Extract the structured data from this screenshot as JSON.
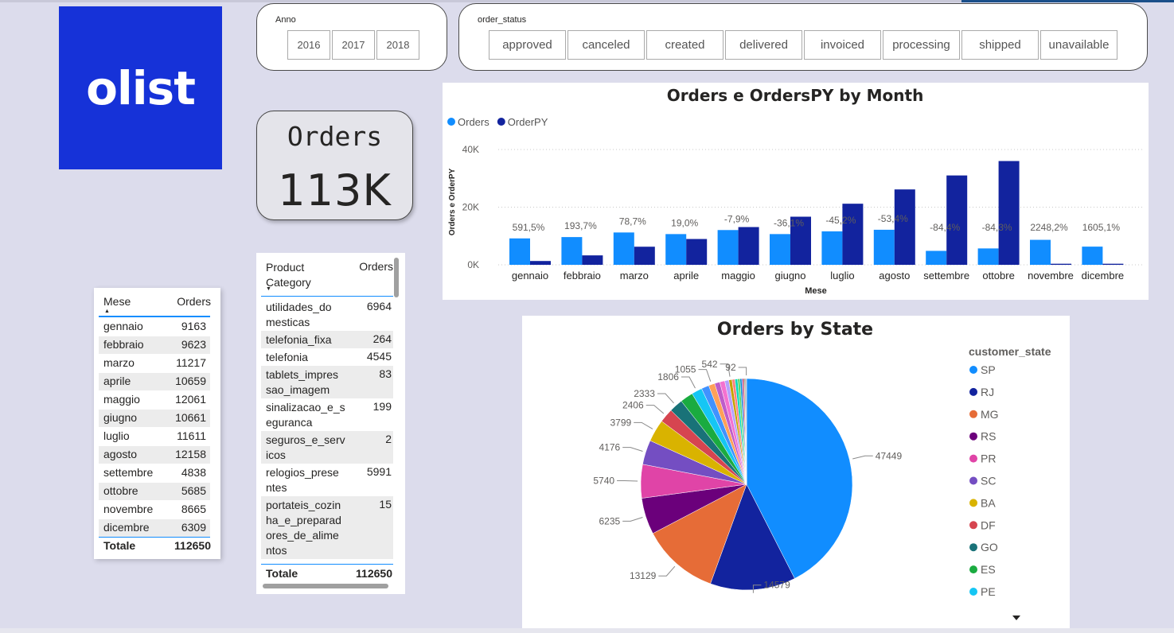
{
  "logo": {
    "text": "olist"
  },
  "anno_slicer": {
    "title": "Anno",
    "items": [
      "2016",
      "2017",
      "2018"
    ]
  },
  "status_slicer": {
    "title": "order_status",
    "items": [
      "approved",
      "canceled",
      "created",
      "delivered",
      "invoiced",
      "processing",
      "shipped",
      "unavailable"
    ]
  },
  "kpi_card": {
    "label": "Orders",
    "value": "113K"
  },
  "month_table": {
    "headers": [
      "Mese",
      "Orders"
    ],
    "rows": [
      [
        "gennaio",
        "9163"
      ],
      [
        "febbraio",
        "9623"
      ],
      [
        "marzo",
        "11217"
      ],
      [
        "aprile",
        "10659"
      ],
      [
        "maggio",
        "12061"
      ],
      [
        "giugno",
        "10661"
      ],
      [
        "luglio",
        "11611"
      ],
      [
        "agosto",
        "12158"
      ],
      [
        "settembre",
        "4838"
      ],
      [
        "ottobre",
        "5685"
      ],
      [
        "novembre",
        "8665"
      ],
      [
        "dicembre",
        "6309"
      ]
    ],
    "total": [
      "Totale",
      "112650"
    ]
  },
  "category_table": {
    "headers": [
      "Product Category",
      "Orders"
    ],
    "rows": [
      [
        [
          "utilidades_do",
          "mesticas"
        ],
        "6964"
      ],
      [
        [
          "telefonia_fixa"
        ],
        "264"
      ],
      [
        [
          "telefonia"
        ],
        "4545"
      ],
      [
        [
          "tablets_impres",
          "sao_imagem"
        ],
        "83"
      ],
      [
        [
          "sinalizacao_e_s",
          "eguranca"
        ],
        "199"
      ],
      [
        [
          "seguros_e_serv",
          "icos"
        ],
        "2"
      ],
      [
        [
          "relogios_prese",
          "ntes"
        ],
        "5991"
      ],
      [
        [
          "portateis_cozin",
          "ha_e_preparad",
          "ores_de_alime",
          "ntos"
        ],
        "15"
      ]
    ],
    "total": [
      "Totale",
      "112650"
    ]
  },
  "chart_data": [
    {
      "type": "bar",
      "title": "Orders e OrdersPY by Month",
      "xlabel": "Mese",
      "ylabel": "Orders e OrderPY",
      "ylim": [
        0,
        40000
      ],
      "yticks": [
        "0K",
        "20K",
        "40K"
      ],
      "yticks_values": [
        0,
        20000,
        40000
      ],
      "legend_position": "top-left",
      "categories": [
        "gennaio",
        "febbraio",
        "marzo",
        "aprile",
        "maggio",
        "giugno",
        "luglio",
        "agosto",
        "settembre",
        "ottobre",
        "novembre",
        "dicembre"
      ],
      "series": [
        {
          "name": "Orders",
          "color": "#118dff",
          "values": [
            9163,
            9623,
            11217,
            10659,
            12061,
            10661,
            11611,
            12158,
            4838,
            5685,
            8665,
            6309
          ]
        },
        {
          "name": "OrderPY",
          "color": "#12239e",
          "values": [
            1325,
            3273,
            6278,
            8957,
            13097,
            16689,
            21193,
            26150,
            31000,
            36000,
            369,
            370
          ]
        }
      ],
      "labels": [
        "591,5%",
        "193,7%",
        "78,7%",
        "19,0%",
        "-7,9%",
        "-36,1%",
        "-45,2%",
        "-53,4%",
        "-84,4%",
        "-84,3%",
        "2248,2%",
        "1605,1%"
      ]
    },
    {
      "type": "pie",
      "title": "Orders by State",
      "legend_title": "customer_state",
      "legend_position": "right",
      "slices": [
        {
          "name": "SP",
          "value": 47449,
          "color": "#118dff",
          "label": "47449"
        },
        {
          "name": "RJ",
          "value": 14579,
          "color": "#12239e",
          "label": "14579"
        },
        {
          "name": "MG",
          "value": 13129,
          "color": "#e66c37",
          "label": "13129"
        },
        {
          "name": "RS",
          "value": 6235,
          "color": "#6b007b",
          "label": "6235"
        },
        {
          "name": "PR",
          "value": 5740,
          "color": "#e044a7",
          "label": "5740"
        },
        {
          "name": "SC",
          "value": 4176,
          "color": "#744ec2",
          "label": "4176"
        },
        {
          "name": "BA",
          "value": 3799,
          "color": "#d9b300",
          "label": "3799"
        },
        {
          "name": "DF",
          "value": 2406,
          "color": "#d64550",
          "label": "2406"
        },
        {
          "name": "GO",
          "value": 2333,
          "color": "#197278",
          "label": "2333"
        },
        {
          "name": "ES",
          "value": 2200,
          "color": "#1aab40",
          "label": ""
        },
        {
          "name": "PE",
          "value": 1806,
          "color": "#15c6f4",
          "label": "1806"
        },
        {
          "name": "",
          "value": 1300,
          "color": "#4092ff",
          "label": ""
        },
        {
          "name": "",
          "value": 1055,
          "color": "#ffa058",
          "label": "1055"
        },
        {
          "name": "",
          "value": 900,
          "color": "#be5dc9",
          "label": ""
        },
        {
          "name": "",
          "value": 850,
          "color": "#f472d0",
          "label": ""
        },
        {
          "name": "",
          "value": 700,
          "color": "#b5a1ff",
          "label": ""
        },
        {
          "name": "",
          "value": 542,
          "color": "#c4a200",
          "label": "542"
        },
        {
          "name": "",
          "value": 500,
          "color": "#ff8080",
          "label": ""
        },
        {
          "name": "",
          "value": 450,
          "color": "#00dbbc",
          "label": ""
        },
        {
          "name": "",
          "value": 400,
          "color": "#5bd667",
          "label": ""
        },
        {
          "name": "",
          "value": 300,
          "color": "#0091d5",
          "label": ""
        },
        {
          "name": "",
          "value": 250,
          "color": "#8e44ad",
          "label": ""
        },
        {
          "name": "",
          "value": 200,
          "color": "#e74c3c",
          "label": ""
        },
        {
          "name": "",
          "value": 150,
          "color": "#16a085",
          "label": ""
        },
        {
          "name": "",
          "value": 120,
          "color": "#a02020",
          "label": ""
        },
        {
          "name": "",
          "value": 92,
          "color": "#2c3e50",
          "label": "92"
        }
      ]
    }
  ]
}
